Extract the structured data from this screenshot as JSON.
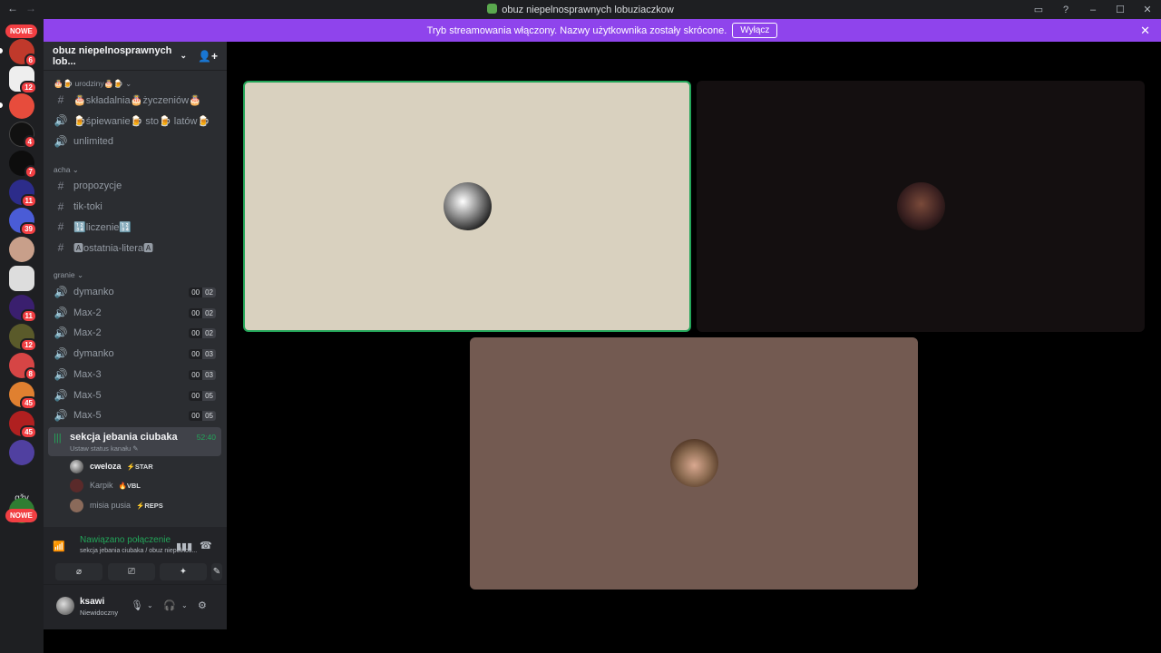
{
  "window": {
    "title": "obuz niepelnosprawnych lobuziaczkow",
    "back": "←",
    "forward": "→",
    "controls": [
      "▭",
      "?",
      "–",
      "☐",
      "✕"
    ]
  },
  "stream_banner": {
    "text": "Tryb streamowania włączony. Nazwy użytkownika zostały skrócone.",
    "button": "Wyłącz",
    "close": "✕"
  },
  "server_rail": {
    "new_label_top": "NOWE",
    "new_label_bottom": "NOWE",
    "folder_label": "gžy",
    "badges": [
      "6",
      "12",
      "4",
      "7",
      "11",
      "39",
      "11",
      "12",
      "8",
      "45",
      "45"
    ]
  },
  "guild": {
    "name": "obuz niepelnosprawnych lob...",
    "chevron": "⌄",
    "invite_icon": "👤+"
  },
  "categories": [
    {
      "name": "🎂🍺 urodziny🎂🍺 ⌄"
    },
    {
      "name": "acha ⌄"
    },
    {
      "name": "granie ⌄"
    }
  ],
  "channels": [
    {
      "icon": "#",
      "name": "🎂składalnia🎂życzeniów🎂"
    },
    {
      "icon": "🔊",
      "name": "🍺śpiewanie🍺 sto🍺 latów🍺"
    },
    {
      "icon": "🔊",
      "name": "unlimited"
    },
    {
      "icon": "#",
      "name": "propozycje"
    },
    {
      "icon": "#",
      "name": "tik-toki"
    },
    {
      "icon": "#",
      "name": "🔢liczenie🔢"
    },
    {
      "icon": "#",
      "name": "🅰ostatnia-litera🅰"
    },
    {
      "icon": "🔊",
      "name": "dymanko",
      "count": [
        "00",
        "02"
      ]
    },
    {
      "icon": "🔊",
      "name": "Max-2",
      "count": [
        "00",
        "02"
      ]
    },
    {
      "icon": "🔊",
      "name": "Max-2",
      "count": [
        "00",
        "02"
      ]
    },
    {
      "icon": "🔊",
      "name": "dymanko",
      "count": [
        "00",
        "03"
      ]
    },
    {
      "icon": "🔊",
      "name": "Max-3",
      "count": [
        "00",
        "03"
      ]
    },
    {
      "icon": "🔊",
      "name": "Max-5",
      "count": [
        "00",
        "05"
      ]
    },
    {
      "icon": "🔊",
      "name": "Max-5",
      "count": [
        "00",
        "05"
      ]
    }
  ],
  "active_channel": {
    "name": "sekcja jebania ciubaka",
    "status": "Ustaw status kanału ✎",
    "time": "52:40",
    "icon": "|||"
  },
  "members": [
    {
      "name": "cweloza",
      "tag": "⚡STAR"
    },
    {
      "name": "Karpik",
      "tag": "🔥VBL"
    },
    {
      "name": "misia pusia",
      "tag": "⚡REPS"
    }
  ],
  "voice_status": {
    "title": "Nawiązano połączenie",
    "subtitle": "sekcja jebania ciubaka / obuz niepelnos...",
    "buttons": [
      "⌀",
      "⎚",
      "✦",
      "✎"
    ]
  },
  "user": {
    "name": "ksawi",
    "status": "Niewidoczny"
  },
  "colors": {
    "banner": "#8f44ec",
    "connected": "#23a559",
    "badge": "#f23f43"
  }
}
